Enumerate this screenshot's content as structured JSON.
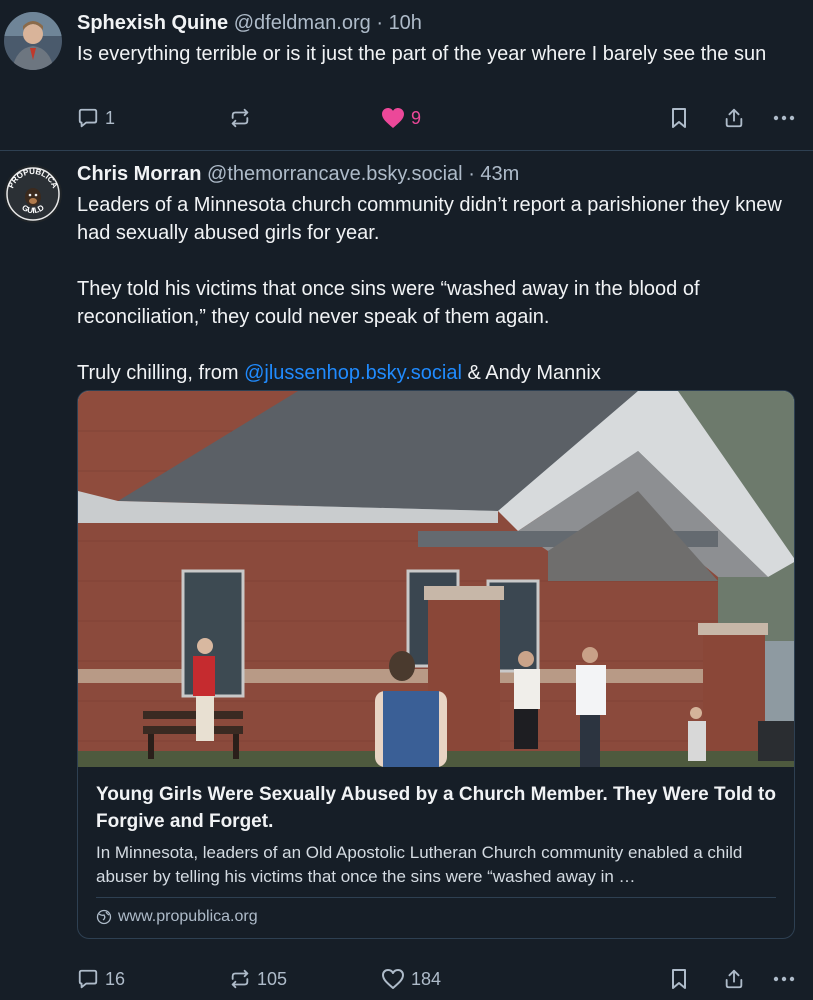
{
  "post1": {
    "display_name": "Sphexish Quine",
    "handle": "@dfeldman.org",
    "separator": "·",
    "time": "10h",
    "text": "Is everything terrible or is it just the part of the year where I barely see the sun",
    "reply_count": "1",
    "repost_count": "",
    "like_count": "9",
    "liked": true
  },
  "post2": {
    "display_name": "Chris Morran",
    "handle": "@themorrancave.bsky.social",
    "separator": "·",
    "time": "43m",
    "avatar_text_top": "PROPUBLICA",
    "avatar_text_bottom": "GUILD",
    "paragraphs": [
      "Leaders of a Minnesota church community didn’t report a parishioner they knew had sexually abused girls for year.",
      "They told his victims that once sins were “washed away in the blood of reconciliation,” they could never speak of them again."
    ],
    "closing_prefix": "Truly chilling, from ",
    "mention": "@jlussenhop.bsky.social",
    "closing_suffix": " & Andy Mannix",
    "card": {
      "title": "Young Girls Were Sexually Abused by a Church Member. They Were Told to Forgive and Forget.",
      "description": "In Minnesota, leaders of an Old Apostolic Lutheran Church community enabled a child abuser by telling his victims that once the sins were “washed away in …",
      "domain": "www.propublica.org"
    },
    "reply_count": "16",
    "repost_count": "105",
    "like_count": "184"
  },
  "colors": {
    "background": "#161e27",
    "text": "#f1f3f5",
    "muted": "#aebbc9",
    "link": "#208bfe",
    "like": "#ec4899",
    "border": "#2e4052"
  }
}
